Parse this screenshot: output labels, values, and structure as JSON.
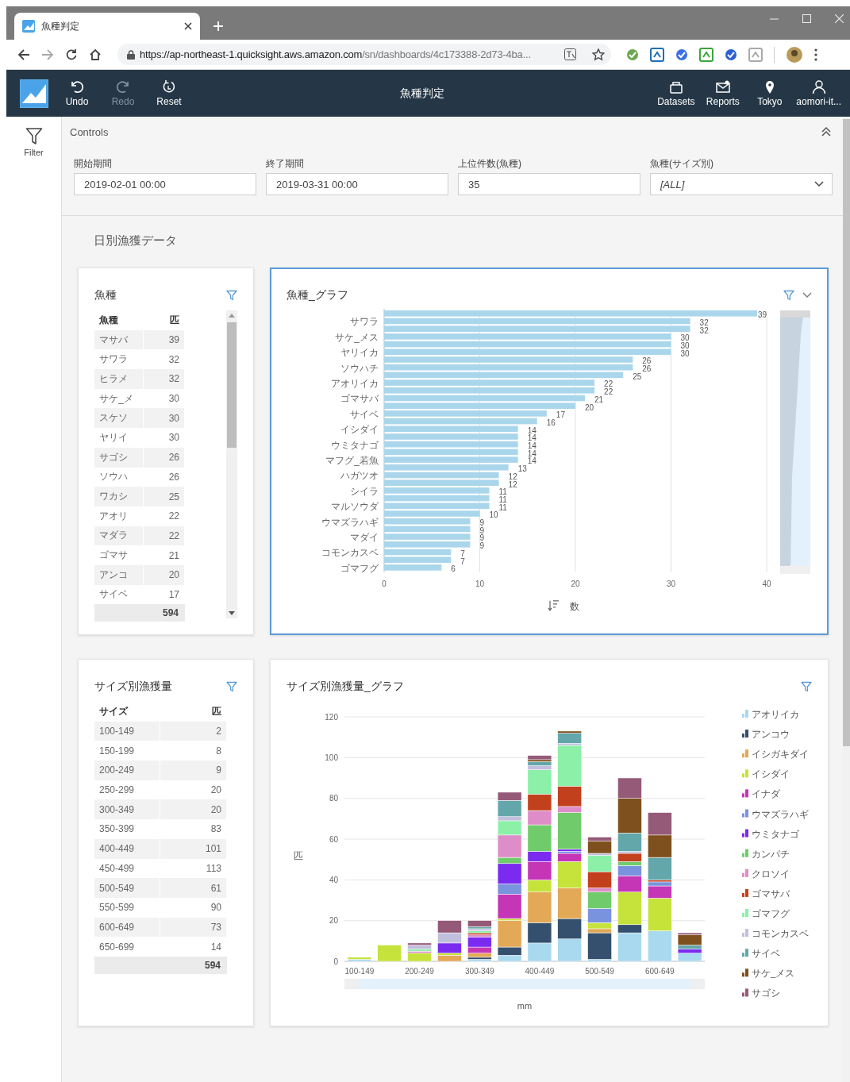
{
  "browser": {
    "tab_title": "魚種判定",
    "url_host": "https://ap-northeast-1.quicksight.aws.amazon.com",
    "url_path": "/sn/dashboards/4c173388-2d73-4ba..."
  },
  "toolbar": {
    "actions": [
      {
        "label": "Undo",
        "disabled": false
      },
      {
        "label": "Redo",
        "disabled": true
      },
      {
        "label": "Reset",
        "disabled": false
      }
    ],
    "title": "魚種判定",
    "nav": [
      {
        "label": "Datasets"
      },
      {
        "label": "Reports"
      },
      {
        "label": "Tokyo"
      },
      {
        "label": "aomori-it..."
      }
    ]
  },
  "sidebar": {
    "label": "Filter"
  },
  "controls": {
    "title": "Controls",
    "fields": [
      {
        "kind": "text",
        "label": "開始期間",
        "value": "2019-02-01 00:00"
      },
      {
        "kind": "text",
        "label": "終了期間",
        "value": "2019-03-31 00:00"
      },
      {
        "kind": "text",
        "label": "上位件数(魚種)",
        "value": "35"
      },
      {
        "kind": "dropdown",
        "label": "魚種(サイズ別)",
        "value": "[ALL]"
      }
    ]
  },
  "sheet": {
    "title": "日別漁獲データ",
    "visuals": [
      {
        "kind": "table",
        "title": "魚種",
        "selected": false,
        "scrollable": true,
        "columns": [
          "魚種",
          "匹"
        ],
        "rows": [
          [
            "マサバ",
            "39"
          ],
          [
            "サワラ",
            "32"
          ],
          [
            "ヒラメ",
            "32"
          ],
          [
            "サケ_メ",
            "30"
          ],
          [
            "スケソ",
            "30"
          ],
          [
            "ヤリイ",
            "30"
          ],
          [
            "サゴシ",
            "26"
          ],
          [
            "ソウハ",
            "26"
          ],
          [
            "ワカシ",
            "25"
          ],
          [
            "アオリ",
            "22"
          ],
          [
            "マダラ",
            "22"
          ],
          [
            "ゴマサ",
            "21"
          ],
          [
            "アンコ",
            "20"
          ],
          [
            "サイベ",
            "17"
          ]
        ],
        "total": "594"
      },
      {
        "kind": "hbar",
        "title": "魚種_グラフ",
        "selected": true,
        "chart_data": {
          "type": "bar",
          "orientation": "horizontal",
          "xlabel": "数",
          "xlim": [
            0,
            40
          ],
          "xticks": [
            0,
            10,
            20,
            30,
            40
          ],
          "grid": true,
          "value_labels": [
            "39",
            "32",
            "32",
            "30",
            "30",
            "30",
            "26",
            "26",
            "25",
            "22",
            "22",
            "21",
            "20",
            "17",
            "16",
            "14",
            "14",
            "14",
            "14",
            "14",
            "13",
            "12",
            "12",
            "11",
            "11",
            "11",
            "10",
            "9",
            "9",
            "9",
            "9",
            "7",
            "7",
            "6"
          ],
          "categories": [
            null,
            "サワラ",
            null,
            "サケ_メス",
            null,
            "ヤリイカ",
            null,
            "ソウハチ",
            null,
            "アオリイカ",
            null,
            "ゴマサバ",
            null,
            "サイベ",
            null,
            "イシダイ",
            null,
            "ウミタナゴ",
            null,
            "マフグ_若魚",
            null,
            "ハガツオ",
            null,
            "シイラ",
            null,
            "マルソウダ",
            null,
            "ウマズラハギ",
            null,
            "マダイ",
            null,
            "コモンカスベ",
            null,
            "ゴマフグ"
          ],
          "values": [
            39,
            32,
            32,
            30,
            30,
            30,
            26,
            26,
            25,
            22,
            22,
            21,
            20,
            17,
            16,
            14,
            14,
            14,
            14,
            14,
            13,
            12,
            12,
            11,
            11,
            11,
            10,
            9,
            9,
            9,
            9,
            7,
            7,
            6
          ]
        }
      },
      {
        "kind": "table",
        "title": "サイズ別漁獲量",
        "selected": false,
        "scrollable": false,
        "columns": [
          "サイズ",
          "匹"
        ],
        "rows": [
          [
            "100-149",
            "2"
          ],
          [
            "150-199",
            "8"
          ],
          [
            "200-249",
            "9"
          ],
          [
            "250-299",
            "20"
          ],
          [
            "300-349",
            "20"
          ],
          [
            "350-399",
            "83"
          ],
          [
            "400-449",
            "101"
          ],
          [
            "450-499",
            "113"
          ],
          [
            "500-549",
            "61"
          ],
          [
            "550-599",
            "90"
          ],
          [
            "600-649",
            "73"
          ],
          [
            "650-699",
            "14"
          ]
        ],
        "total": "594"
      },
      {
        "kind": "stacked",
        "title": "サイズ別漁獲量_グラフ",
        "selected": false,
        "chart_data": {
          "type": "bar",
          "stacked": true,
          "xlabel": "mm",
          "ylabel": "匹",
          "ylim": [
            0,
            120
          ],
          "yticks": [
            0,
            20,
            40,
            60,
            80,
            100,
            120
          ],
          "grid": true,
          "legend": true,
          "categories": [
            "100-149",
            null,
            "200-249",
            null,
            "300-349",
            null,
            "400-449",
            null,
            "500-549",
            null,
            "600-649",
            null
          ],
          "series": [
            {
              "name": "アオリイカ",
              "color": "#a9d9ef",
              "values": [
                1,
                0,
                0,
                0,
                1,
                3,
                9,
                11,
                1,
                14,
                15,
                4
              ]
            },
            {
              "name": "アンコウ",
              "color": "#35506e",
              "values": [
                0,
                0,
                0,
                0,
                1,
                4,
                10,
                10,
                13,
                4,
                0,
                0
              ]
            },
            {
              "name": "イシガキダイ",
              "color": "#e3a957",
              "values": [
                0,
                0,
                0,
                3,
                2,
                13,
                15,
                15,
                2,
                0,
                0,
                0
              ]
            },
            {
              "name": "イシダイ",
              "color": "#c5e33b",
              "values": [
                1,
                8,
                4,
                1,
                0,
                1,
                6,
                13,
                3,
                16,
                16,
                0
              ]
            },
            {
              "name": "イナダ",
              "color": "#c536b6",
              "values": [
                0,
                0,
                0,
                0,
                3,
                12,
                9,
                4,
                0,
                8,
                6,
                0
              ]
            },
            {
              "name": "ウマズラハギ",
              "color": "#7a93de",
              "values": [
                0,
                0,
                0,
                0,
                0,
                5,
                0,
                1,
                7,
                5,
                2,
                0
              ]
            },
            {
              "name": "ウミタナゴ",
              "color": "#7b2bf0",
              "values": [
                0,
                0,
                0,
                5,
                5,
                10,
                5,
                1,
                0,
                0,
                0,
                2
              ]
            },
            {
              "name": "カンパチ",
              "color": "#70cc6b",
              "values": [
                0,
                0,
                0,
                0,
                0,
                3,
                13,
                18,
                8,
                2,
                0,
                0
              ]
            },
            {
              "name": "クロソイ",
              "color": "#de8dc8",
              "values": [
                0,
                0,
                1,
                0,
                1,
                11,
                7,
                3,
                2,
                0,
                0,
                0
              ]
            },
            {
              "name": "ゴマサバ",
              "color": "#c3401d",
              "values": [
                0,
                0,
                0,
                0,
                1,
                0,
                8,
                10,
                8,
                4,
                1,
                0
              ]
            },
            {
              "name": "ゴマフグ",
              "color": "#8cf0a8",
              "values": [
                0,
                0,
                1,
                0,
                1,
                7,
                12,
                20,
                8,
                0,
                0,
                0
              ]
            },
            {
              "name": "コモンカスベ",
              "color": "#c1bfde",
              "values": [
                0,
                0,
                2,
                5,
                1,
                2,
                2,
                1,
                1,
                1,
                0,
                0
              ]
            },
            {
              "name": "サイベ",
              "color": "#63a7ab",
              "values": [
                0,
                0,
                0,
                0,
                1,
                8,
                2,
                5,
                0,
                9,
                11,
                2
              ]
            },
            {
              "name": "サケ_メス",
              "color": "#7d501d",
              "values": [
                0,
                0,
                0,
                0,
                0,
                0,
                1,
                1,
                6,
                17,
                11,
                5
              ]
            },
            {
              "name": "サゴシ",
              "color": "#955a78",
              "values": [
                0,
                0,
                1,
                6,
                3,
                4,
                2,
                0,
                2,
                10,
                11,
                1
              ]
            }
          ]
        }
      }
    ]
  }
}
